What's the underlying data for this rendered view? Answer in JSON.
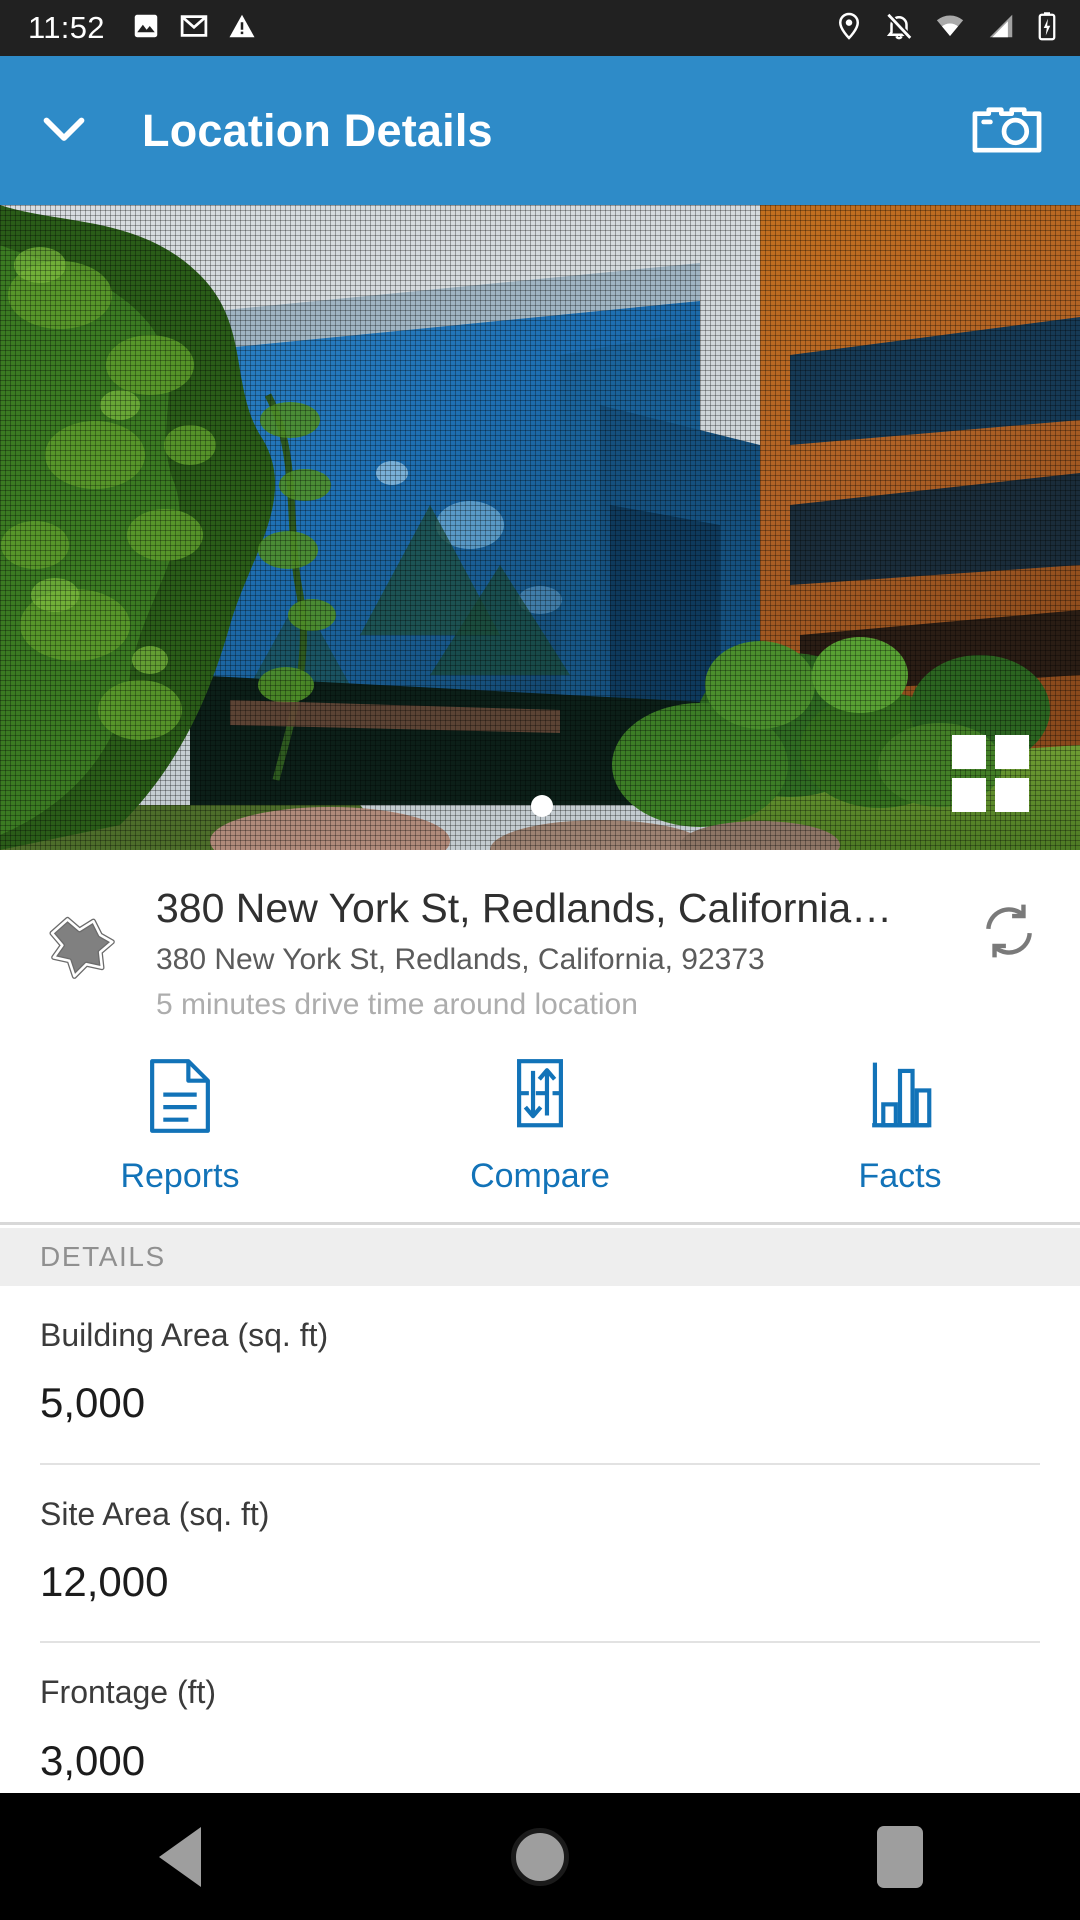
{
  "status_bar": {
    "time": "11:52",
    "left_icons": [
      "image-icon",
      "gmail-icon",
      "warning-icon"
    ],
    "right_icons": [
      "location-pin-icon",
      "notifications-off-icon",
      "wifi-icon",
      "cellular-signal-icon",
      "battery-charging-icon"
    ]
  },
  "app_bar": {
    "back_icon": "chevron-down-icon",
    "title": "Location Details",
    "camera_icon": "camera-icon",
    "color": "#2E8BC8"
  },
  "photo": {
    "alt": "Modern office building with blue glass facade and orange brick wing surrounded by trees",
    "page_indicator_count": 1,
    "page_indicator_active": 1,
    "grid_icon": "grid-view-icon"
  },
  "location": {
    "shape_icon": "drive-time-polygon-icon",
    "title": "380 New York St, Redlands, California…",
    "address": "380 New York St, Redlands, California, 92373",
    "note": "5 minutes drive time around location",
    "refresh_icon": "refresh-icon"
  },
  "actions": [
    {
      "icon": "report-document-icon",
      "label": "Reports"
    },
    {
      "icon": "compare-arrows-icon",
      "label": "Compare"
    },
    {
      "icon": "bar-chart-icon",
      "label": "Facts"
    }
  ],
  "details": {
    "header": "DETAILS",
    "rows": [
      {
        "label": "Building Area (sq. ft)",
        "value": "5,000"
      },
      {
        "label": "Site Area (sq. ft)",
        "value": "12,000"
      },
      {
        "label": "Frontage (ft)",
        "value": "3,000"
      }
    ]
  },
  "nav_bar": {
    "back": "back-triangle-icon",
    "home": "home-circle-icon",
    "recents": "recents-square-icon"
  },
  "colors": {
    "accent_blue": "#1273B8",
    "app_bar_blue": "#2E8BC8",
    "section_header_bg": "#eeeeee"
  }
}
